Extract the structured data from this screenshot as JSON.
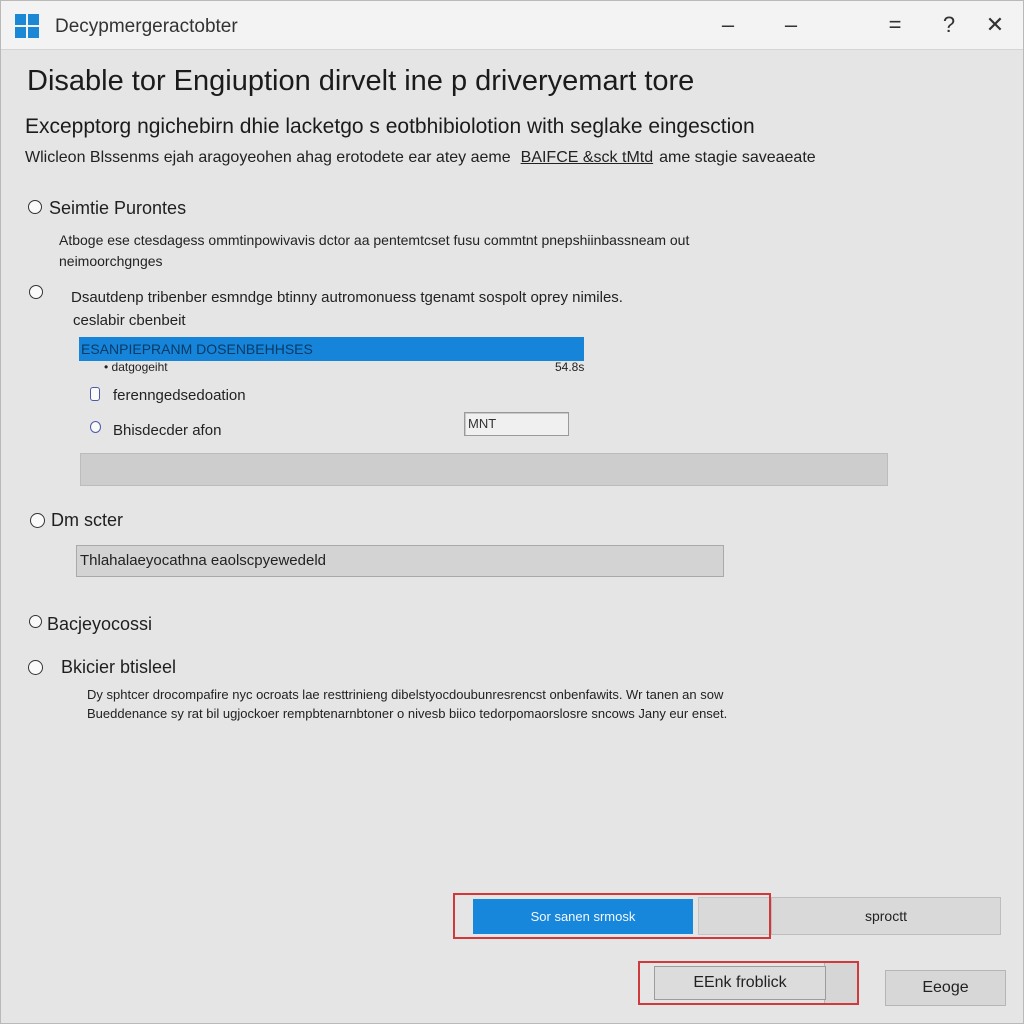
{
  "window": {
    "app_title": "Decypmergeractobter",
    "controls": {
      "minimize": "–",
      "maximize": "–",
      "restore": "=",
      "help": "?",
      "close": "✕"
    }
  },
  "header": {
    "title": "Disable tor Engiuption dirvelt ine p driveryemart tore",
    "subtitle": "Excepptorg ngichebirn dhie lacketgo s eotbhibiolotion with seglake eingesction",
    "description": "Wlicleon Blssenms ejah aragoyeohen ahag erotodete ear atey aeme",
    "description_link": "BAIFCE &sck tMtd",
    "description_tail": "ame stagie saveaeate"
  },
  "options": {
    "option1": {
      "label": "Seimtie Purontes",
      "desc_line1": "Atboge ese ctesdagess ommtinpowivavis dctor aa pentemtcset fusu commtnt pnepshiinbassneam out",
      "desc_line2": "neimoorchgnges"
    },
    "option2": {
      "label_line1": "Dsautdenp tribenber esmndge btinny autromonuess tgenamt sospolt oprey nimiles.",
      "label_line2": "ceslabir cbenbeit"
    },
    "progress": {
      "bar_text": "ESANPIEPRANM DOSENBEHHSES",
      "sub_label": "datgogeiht",
      "value_text": "54.8s"
    },
    "sub_choice1": {
      "label": "ferenngedsedoation"
    },
    "sub_choice2": {
      "label": "Bhisdecder afon",
      "input_value": "MNT"
    },
    "option3": {
      "label": "Dm scter",
      "path_value": "Thlahalaeyocathna eaolscpyewedeld"
    },
    "option4": {
      "label": "Bacjeyocossi"
    },
    "option5": {
      "label": "Bkicier btisleel",
      "desc_line1": "Dy sphtcer drocompafire nyc ocroats lae resttrinieng dibelstyocdoubunresrencst onbenfawits. Wr tanen an sow",
      "desc_line2": "Bueddenance sy rat bil ugjockoer rempbtenarnbtoner o nivesb biico tedorpomaorslosre sncows   Jany eur enset."
    }
  },
  "footer": {
    "primary_button": "Sor sanen srmosk",
    "secondary_button": "sproctt",
    "back_button": "EEnk froblick",
    "close_button": "Eeoge"
  },
  "colors": {
    "accent_blue": "#1787dc",
    "highlight_red": "#d2383a",
    "window_bg": "#e5e5e5"
  },
  "icons": {
    "app": "windows-logo-icon"
  }
}
